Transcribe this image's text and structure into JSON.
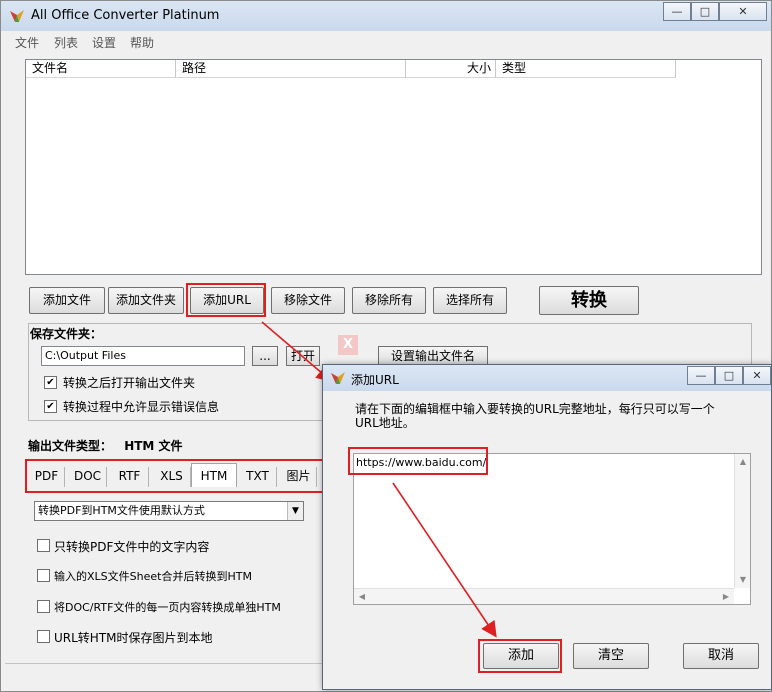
{
  "window": {
    "title": "All Office Converter Platinum",
    "controls": {
      "minimize": "—",
      "maximize": "□",
      "close": "✕"
    }
  },
  "menu": {
    "items": [
      "文件",
      "列表",
      "设置",
      "帮助"
    ]
  },
  "file_list": {
    "columns": [
      "文件名",
      "路径",
      "大小",
      "类型"
    ]
  },
  "toolbar": {
    "add_file": "添加文件",
    "add_folder": "添加文件夹",
    "add_url": "添加URL",
    "remove_file": "移除文件",
    "remove_all": "移除所有",
    "select_all": "选择所有",
    "convert": "转换"
  },
  "save_folder": {
    "title": "保存文件夹：",
    "path": "C:\\Output Files",
    "browse": "...",
    "open": "打开",
    "set_output_name": "设置输出文件名",
    "open_after": "转换之后打开输出文件夹",
    "show_errors": "转换过程中允许显示错误信息"
  },
  "output": {
    "label": "输出文件类型：",
    "value": "HTM 文件",
    "tabs": [
      "PDF",
      "DOC",
      "RTF",
      "XLS",
      "HTM",
      "TXT",
      "图片"
    ],
    "active_tab": "HTM",
    "mode_select": "转换PDF到HTM文件使用默认方式",
    "options": [
      "只转换PDF文件中的文字内容",
      "输入的XLS文件Sheet合并后转换到HTM",
      "将DOC/RTF文件的每一页内容转换成单独HTM",
      "URL转HTM时保存图片到本地"
    ]
  },
  "watermark": {
    "glyph": "X"
  },
  "dialog": {
    "title": "添加URL",
    "instruction": "请在下面的编辑框中输入要转换的URL完整地址，每行只可以写一个URL地址。",
    "url_value": "https://www.baidu.com/",
    "add": "添加",
    "clear": "清空",
    "cancel": "取消"
  },
  "colors": {
    "highlight": "#e02020",
    "titlebar": "#c9d9ec"
  },
  "icons": {
    "app": "app-logo-icon",
    "checkmark": "✔",
    "dropdown": "▼"
  }
}
